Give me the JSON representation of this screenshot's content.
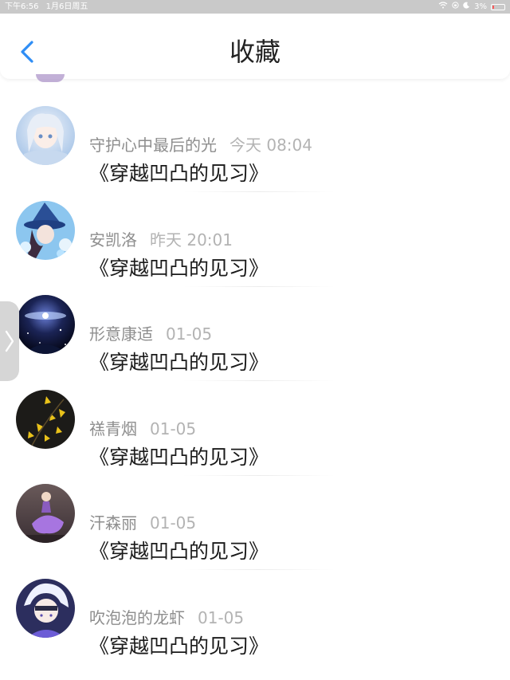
{
  "status_bar": {
    "time": "下午6:56",
    "date": "1月6日周五",
    "battery": "3%",
    "battery_level": 0.03
  },
  "header": {
    "title": "收藏"
  },
  "items": [
    {
      "name": "守护心中最后的光",
      "time": "今天 08:04",
      "book": "《穿越凹凸的见习》",
      "avatar_icon": "avatar-anime-white-hair"
    },
    {
      "name": "安凯洛",
      "time": "昨天 20:01",
      "book": "《穿越凹凸的见习》",
      "avatar_icon": "avatar-anime-blue-witch"
    },
    {
      "name": "形意康适",
      "time": "01-05",
      "book": "《穿越凹凸的见习》",
      "avatar_icon": "avatar-galaxy"
    },
    {
      "name": "禚青烟",
      "time": "01-05",
      "book": "《穿越凹凸的见习》",
      "avatar_icon": "avatar-yellow-flowers"
    },
    {
      "name": "汗森丽",
      "time": "01-05",
      "book": "《穿越凹凸的见习》",
      "avatar_icon": "avatar-purple-dress"
    },
    {
      "name": "吹泡泡的龙虾",
      "time": "01-05",
      "book": "《穿越凹凸的见习》",
      "avatar_icon": "avatar-anime-white-hair-boy"
    }
  ],
  "colors": {
    "accent": "#2f8ef5",
    "text_primary": "#1a1a1a",
    "text_secondary": "#9a9a9a"
  }
}
